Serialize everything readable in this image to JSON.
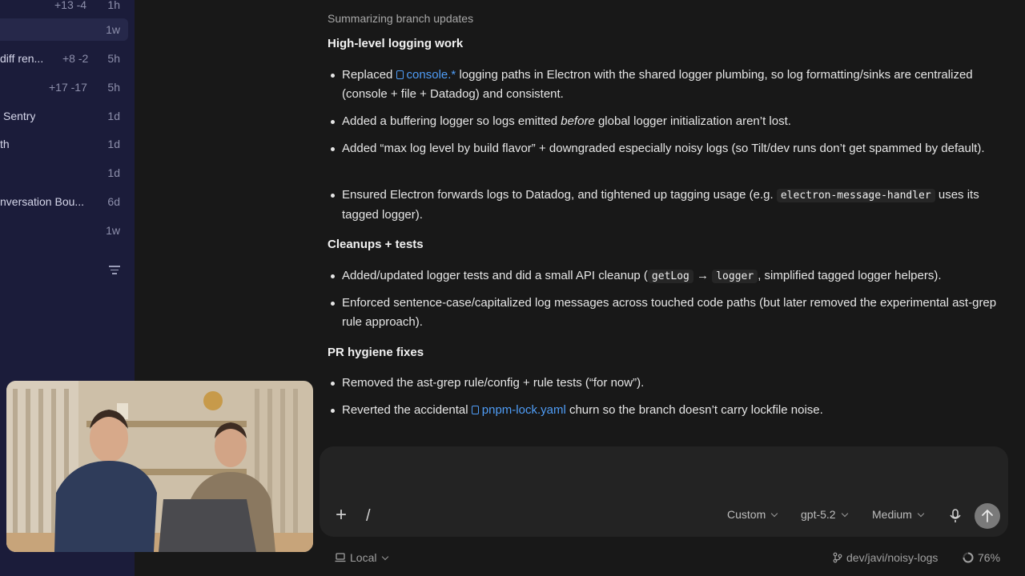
{
  "sidebar": {
    "rows": [
      {
        "title": "",
        "stats": "+13 -4",
        "time": "1h"
      },
      {
        "title": "",
        "stats": "",
        "time": "1w"
      },
      {
        "title": "diff ren...",
        "stats": "+8 -2",
        "time": "5h"
      },
      {
        "title": "",
        "stats": "+17 -17",
        "time": "5h"
      },
      {
        "title": "Sentry",
        "stats": "",
        "time": "1d"
      },
      {
        "title": "th",
        "stats": "",
        "time": "1d"
      },
      {
        "title": "",
        "stats": "",
        "time": "1d"
      },
      {
        "title": "nversation Bou...",
        "stats": "",
        "time": "6d"
      },
      {
        "title": "",
        "stats": "",
        "time": "1w"
      }
    ]
  },
  "thread": {
    "status": "Summarizing branch updates",
    "sections": [
      {
        "heading": "High-level logging work",
        "bullets": [
          {
            "parts": [
              "Replaced ",
              "console.*",
              " logging paths in Electron with the shared logger plumbing, so log formatting/sinks are centralized (console + file + Datadog) and consistent."
            ]
          },
          {
            "parts": [
              "Added a buffering logger so logs emitted ",
              "before",
              " global logger initialization aren’t lost."
            ]
          },
          {
            "parts": [
              "Added “max log level by build flavor” + downgraded especially noisy logs (so Tilt/dev runs don’t get spammed by default)."
            ]
          },
          {
            "parts": [
              "Ensured Electron forwards logs to Datadog, and tightened up tagging usage (e.g. ",
              "electron-message-handler",
              " uses its tagged logger)."
            ]
          }
        ]
      },
      {
        "heading": "Cleanups + tests",
        "bullets": [
          {
            "parts": [
              "Added/updated logger tests and did a small API cleanup (",
              "getLog",
              " → ",
              "logger",
              ", simplified tagged logger helpers)."
            ]
          },
          {
            "parts": [
              "Enforced sentence-case/capitalized log messages across touched code paths (but later removed the experimental ast-grep rule approach)."
            ]
          }
        ]
      },
      {
        "heading": "PR hygiene fixes",
        "bullets": [
          {
            "parts": [
              "Removed the ast-grep rule/config + rule tests (“for now”)."
            ]
          },
          {
            "parts": [
              "Reverted the accidental ",
              "pnpm-lock.yaml",
              " churn so the branch doesn’t carry lockfile noise."
            ]
          }
        ]
      }
    ]
  },
  "composer": {
    "mode": "Custom",
    "model": "gpt-5.2",
    "effort": "Medium"
  },
  "footer": {
    "env": "Local",
    "branch": "dev/javi/noisy-logs",
    "context_pct": "76%"
  },
  "colors": {
    "accent_link": "#4f9df7",
    "sidebar_bg": "#1b1c3a",
    "main_bg": "#181818"
  }
}
